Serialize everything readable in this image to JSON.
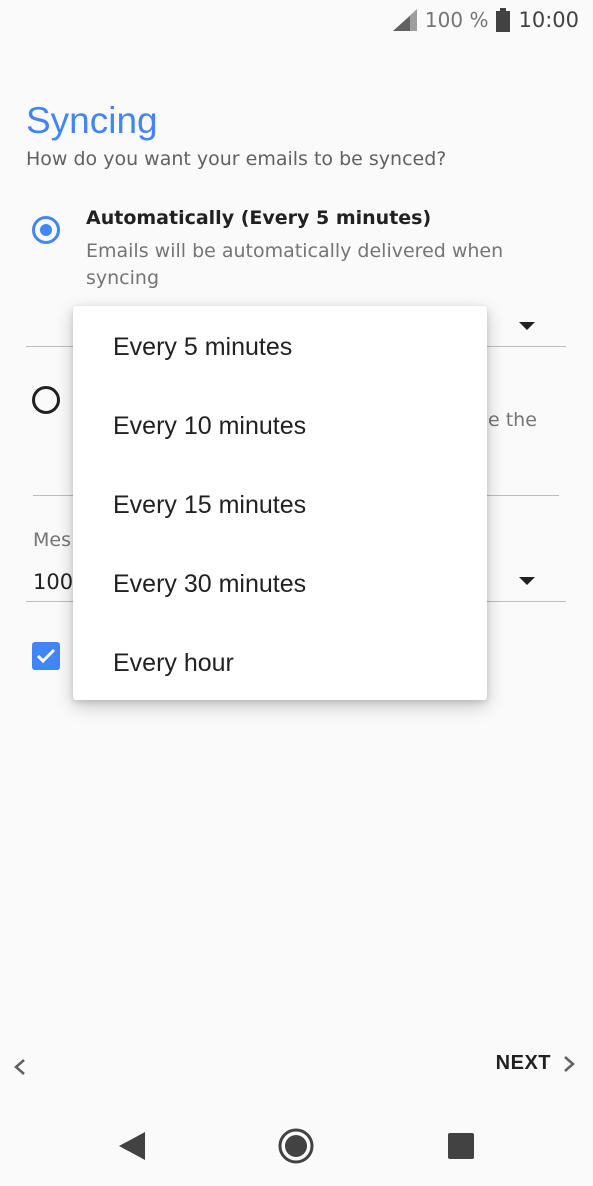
{
  "status_bar": {
    "battery_text": "100 %",
    "time": "10:00",
    "signal_icon": "signal-icon",
    "battery_icon": "battery-icon"
  },
  "page": {
    "title": "Syncing",
    "subtitle": "How do you want your emails to be synced?"
  },
  "options": {
    "auto_title": "Automatically (Every 5 minutes)",
    "auto_desc": "Emails will be automatically delivered when syncing",
    "manual_peek": "e the",
    "messages_label_peek": "Mes",
    "messages_value_peek": "100"
  },
  "dropdown": {
    "items": [
      "Every 5 minutes",
      "Every 10 minutes",
      "Every 15 minutes",
      "Every 30 minutes",
      "Every hour"
    ]
  },
  "footer": {
    "next_label": "NEXT"
  },
  "colors": {
    "accent": "#4285f4",
    "background": "#fafafa"
  }
}
